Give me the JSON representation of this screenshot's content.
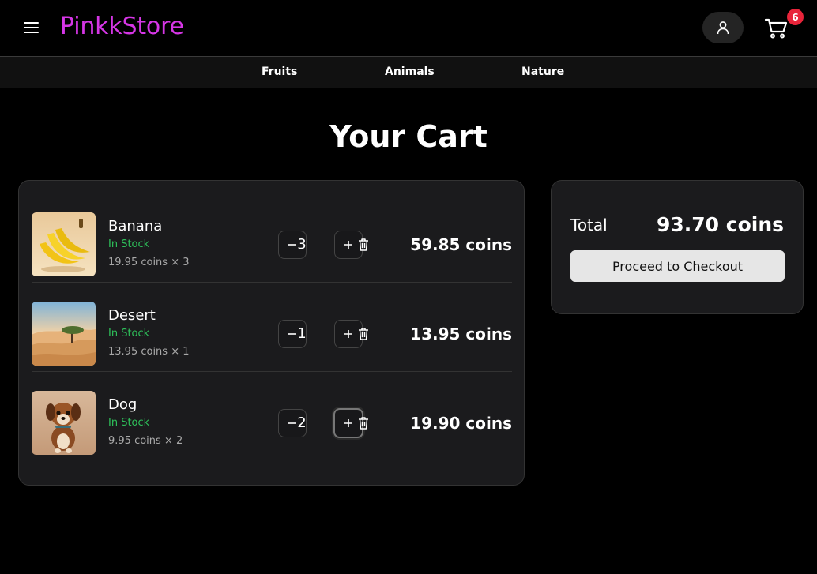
{
  "header": {
    "brand": "PinkkStore",
    "cart_count": "6"
  },
  "nav": {
    "items": [
      {
        "label": "Fruits"
      },
      {
        "label": "Animals"
      },
      {
        "label": "Nature"
      }
    ]
  },
  "page": {
    "title": "Your Cart"
  },
  "cart": {
    "items": [
      {
        "name": "Banana",
        "stock": "In Stock",
        "unit": "19.95 coins × 3",
        "qty": "3",
        "total": "59.85 coins",
        "image": "banana-image"
      },
      {
        "name": "Desert",
        "stock": "In Stock",
        "unit": "13.95 coins × 1",
        "qty": "1",
        "total": "13.95 coins",
        "image": "desert-image"
      },
      {
        "name": "Dog",
        "stock": "In Stock",
        "unit": "9.95 coins × 2",
        "qty": "2",
        "total": "19.90 coins",
        "image": "dog-image"
      }
    ]
  },
  "summary": {
    "total_label": "Total",
    "total_value": "93.70 coins",
    "checkout_label": "Proceed to Checkout"
  },
  "colors": {
    "brand": "#d636e6",
    "stock": "#2ec05a",
    "badge": "#e8243a"
  }
}
